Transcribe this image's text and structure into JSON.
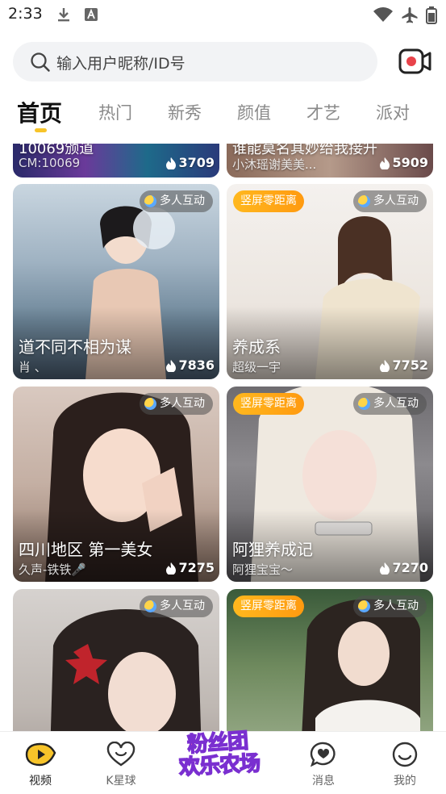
{
  "status": {
    "time": "2:33"
  },
  "search": {
    "placeholder": "输入用户昵称/ID号"
  },
  "tabs": [
    {
      "label": "首页",
      "active": true
    },
    {
      "label": "热门"
    },
    {
      "label": "新秀"
    },
    {
      "label": "颜值"
    },
    {
      "label": "才艺"
    },
    {
      "label": "派对"
    }
  ],
  "feed": {
    "top_row": [
      {
        "title": "10069颁道",
        "subtitle": "CM:10069",
        "heat": "3709"
      },
      {
        "title": "谁能莫名其妙给我接升",
        "subtitle": "小沐瑶谢美美...",
        "heat": "5909"
      }
    ],
    "cards": [
      {
        "title": "道不同不相为谋",
        "subtitle": "肖 、",
        "heat": "7836",
        "tag": "",
        "multi": "多人互动"
      },
      {
        "title": "养成系",
        "subtitle": "超级一宇",
        "heat": "7752",
        "tag": "竖屏零距离",
        "multi": "多人互动"
      },
      {
        "title": "四川地区 第一美女",
        "subtitle": "久声-铁铁🎤",
        "heat": "7275",
        "tag": "",
        "multi": "多人互动"
      },
      {
        "title": "阿狸养成记",
        "subtitle": "阿狸宝宝〜",
        "heat": "7270",
        "tag": "竖屏零距离",
        "multi": "多人互动"
      },
      {
        "title": "",
        "subtitle": "",
        "heat": "",
        "tag": "",
        "multi": "多人互动"
      },
      {
        "title": "",
        "subtitle": "",
        "heat": "",
        "tag": "竖屏零距离",
        "multi": "多人互动"
      }
    ]
  },
  "promo": {
    "line1": "粉丝团",
    "line2": "欢乐农场"
  },
  "nav": [
    {
      "label": "视频",
      "icon": "video-icon",
      "active": true
    },
    {
      "label": "K星球",
      "icon": "heart-icon"
    },
    {
      "label": "消息",
      "icon": "message-icon"
    },
    {
      "label": "我的",
      "icon": "profile-icon"
    }
  ],
  "colors": {
    "accent": "#f7c42a",
    "tag": "#ff9f14",
    "camera": "#e8434a"
  }
}
